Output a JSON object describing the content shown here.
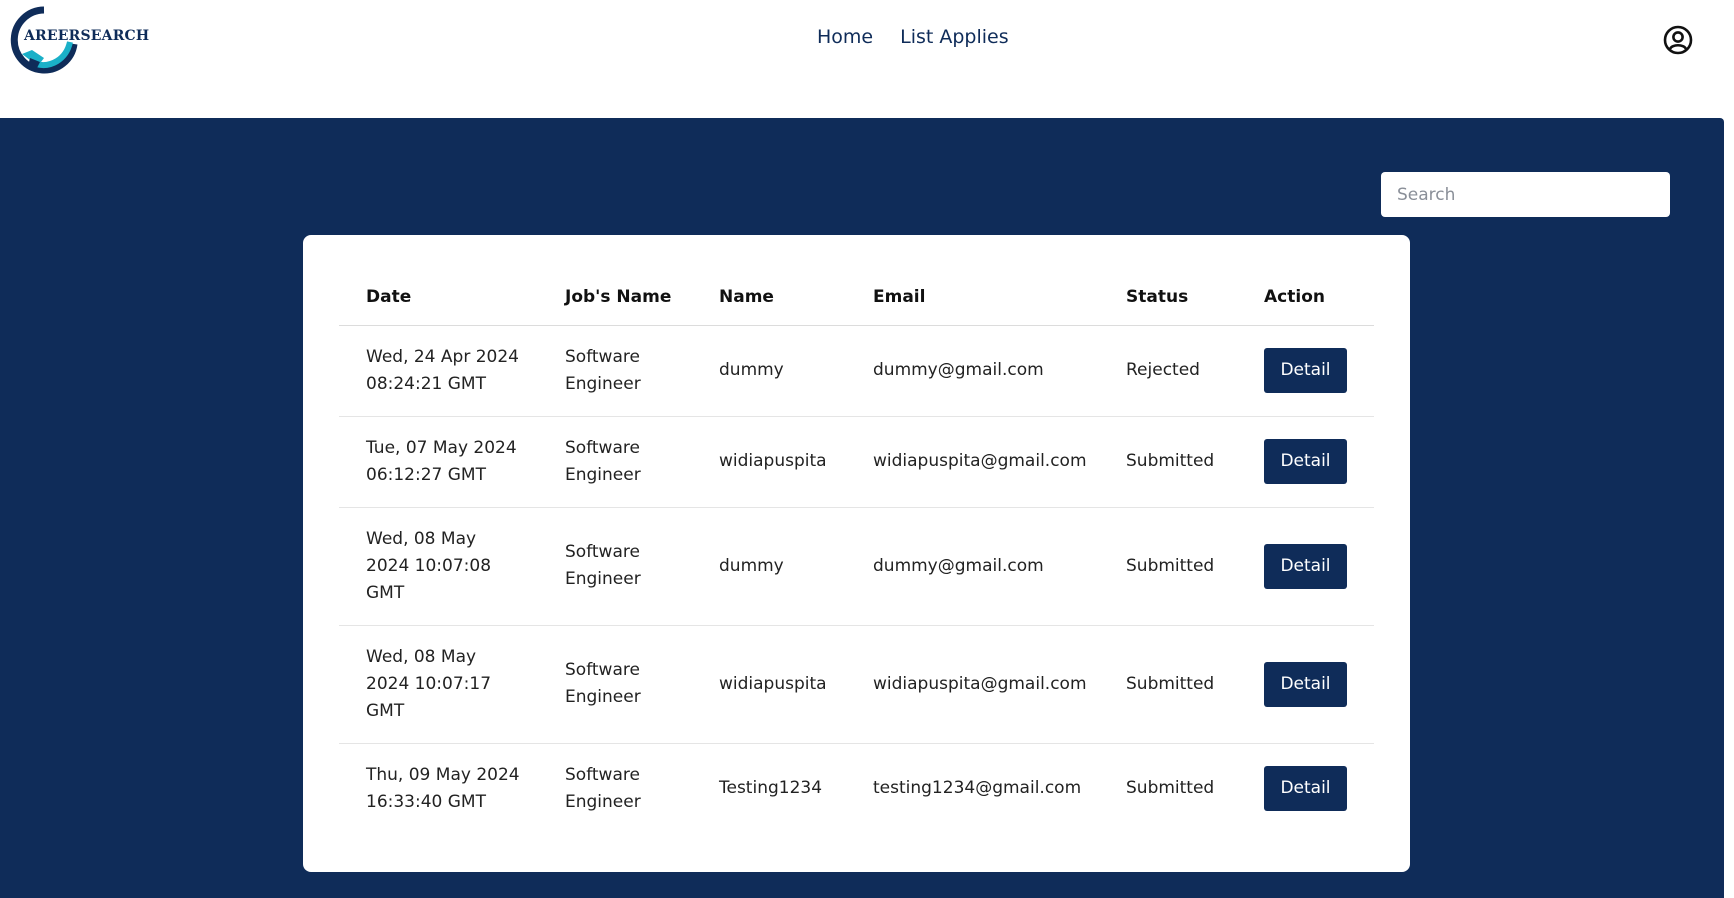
{
  "header": {
    "logo_text": "AREERSEARCH",
    "nav": [
      {
        "label": "Home"
      },
      {
        "label": "List Applies"
      }
    ]
  },
  "search": {
    "placeholder": "Search",
    "value": ""
  },
  "table": {
    "columns": [
      "Date",
      "Job's Name",
      "Name",
      "Email",
      "Status",
      "Action"
    ],
    "rows": [
      {
        "date": "Wed, 24 Apr 2024 08:24:21 GMT",
        "job": "Software Engineer",
        "name": "dummy",
        "email": "dummy@gmail.com",
        "status": "Rejected",
        "action": "Detail"
      },
      {
        "date": "Tue, 07 May 2024 06:12:27 GMT",
        "job": "Software Engineer",
        "name": "widiapuspita",
        "email": "widiapuspita@gmail.com",
        "status": "Submitted",
        "action": "Detail"
      },
      {
        "date": "Wed, 08 May 2024 10:07:08 GMT",
        "job": "Software Engineer",
        "name": "dummy",
        "email": "dummy@gmail.com",
        "status": "Submitted",
        "action": "Detail"
      },
      {
        "date": "Wed, 08 May 2024 10:07:17 GMT",
        "job": "Software Engineer",
        "name": "widiapuspita",
        "email": "widiapuspita@gmail.com",
        "status": "Submitted",
        "action": "Detail"
      },
      {
        "date": "Thu, 09 May 2024 16:33:40 GMT",
        "job": "Software Engineer",
        "name": "Testing1234",
        "email": "testing1234@gmail.com",
        "status": "Submitted",
        "action": "Detail"
      }
    ]
  },
  "colors": {
    "brand_navy": "#0f2c59",
    "logo_teal": "#1ab0c8",
    "background": "#ffffff"
  },
  "icons": {
    "profile": "user-circle-icon",
    "logo": "handshake-logo-icon"
  }
}
